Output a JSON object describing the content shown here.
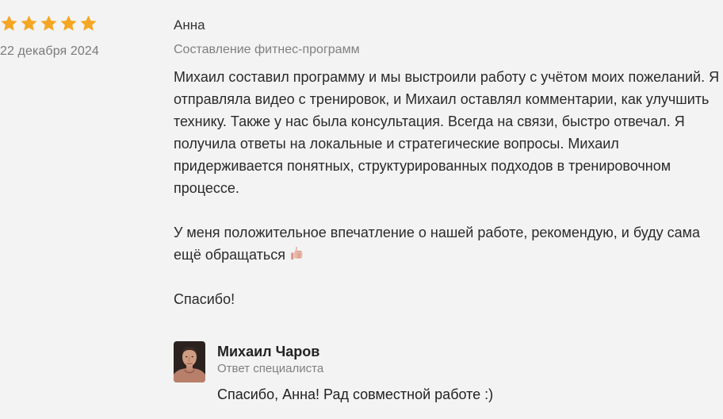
{
  "review": {
    "rating": 5,
    "rating_max": 5,
    "star_color": "#f5a623",
    "date": "22 декабря 2024",
    "author": "Анна",
    "service": "Составление фитнес-программ",
    "paragraph1": "Михаил составил программу и мы выстроили работу с учётом моих пожеланий. Я отправляла видео с тренировок, и Михаил оставлял комментарии, как улучшить технику. Также у нас была консультация. Всегда на связи, быстро отвечал. Я получила ответы на локальные и стратегические вопросы. Михаил придерживается понятных, структурированных подходов в тренировочном процессе.",
    "paragraph2": "У меня положительное впечатление о нашей работе, рекомендую, и буду сама ещё обращаться",
    "paragraph2_icon": "thumbs-up-icon",
    "paragraph3": "Спасибо!"
  },
  "reply": {
    "name": "Михаил Чаров",
    "role": "Ответ специалиста",
    "text": "Спасибо, Анна! Рад совместной работе :)"
  }
}
